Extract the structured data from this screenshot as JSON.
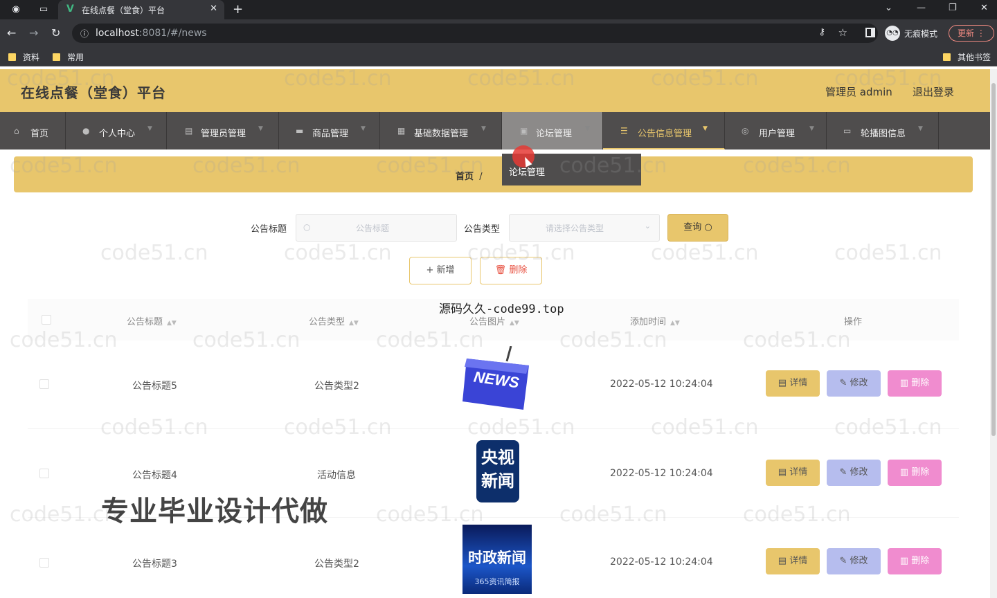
{
  "browser": {
    "tab_title": "在线点餐（堂食）平台",
    "url_host": "localhost",
    "url_rest": ":8081/#/news",
    "incognito_label": "无痕模式",
    "update_label": "更新",
    "bookmarks": [
      "资料",
      "常用"
    ],
    "other_bookmarks": "其他书签"
  },
  "header": {
    "title": "在线点餐（堂食）平台",
    "user": "管理员 admin",
    "logout": "退出登录"
  },
  "menu": [
    {
      "label": "首页"
    },
    {
      "label": "个人中心"
    },
    {
      "label": "管理员管理"
    },
    {
      "label": "商品管理"
    },
    {
      "label": "基础数据管理"
    },
    {
      "label": "论坛管理"
    },
    {
      "label": "公告信息管理"
    },
    {
      "label": "用户管理"
    },
    {
      "label": "轮播图信息"
    }
  ],
  "breadcrumb": {
    "home": "首页",
    "sep": "/"
  },
  "dropdown": {
    "item": "论坛管理"
  },
  "search": {
    "title_label": "公告标题",
    "title_placeholder": "公告标题",
    "type_label": "公告类型",
    "type_placeholder": "请选择公告类型",
    "query_button": "查询"
  },
  "actions": {
    "add": "新增",
    "delete": "删除"
  },
  "table": {
    "headers": [
      "公告标题",
      "公告类型",
      "公告图片",
      "添加时间",
      "操作"
    ],
    "rows": [
      {
        "title": "公告标题5",
        "type": "公告类型2",
        "image": "news-3d",
        "time": "2022-05-12 10:24:04"
      },
      {
        "title": "公告标题4",
        "type": "活动信息",
        "image": "cctv-news",
        "time": "2022-05-12 10:24:04",
        "image_text": [
          "央视",
          "新闻"
        ]
      },
      {
        "title": "公告标题3",
        "type": "公告类型2",
        "image": "politics-news",
        "time": "2022-05-12 10:24:04",
        "image_text": [
          "时政新闻",
          "365资讯简报"
        ]
      }
    ],
    "row_actions": {
      "detail": "详情",
      "edit": "修改",
      "remove": "删除"
    }
  },
  "overlays": {
    "top": "源码久久-code99.top",
    "big": "专业毕业设计代做",
    "watermark": "code51.cn"
  }
}
